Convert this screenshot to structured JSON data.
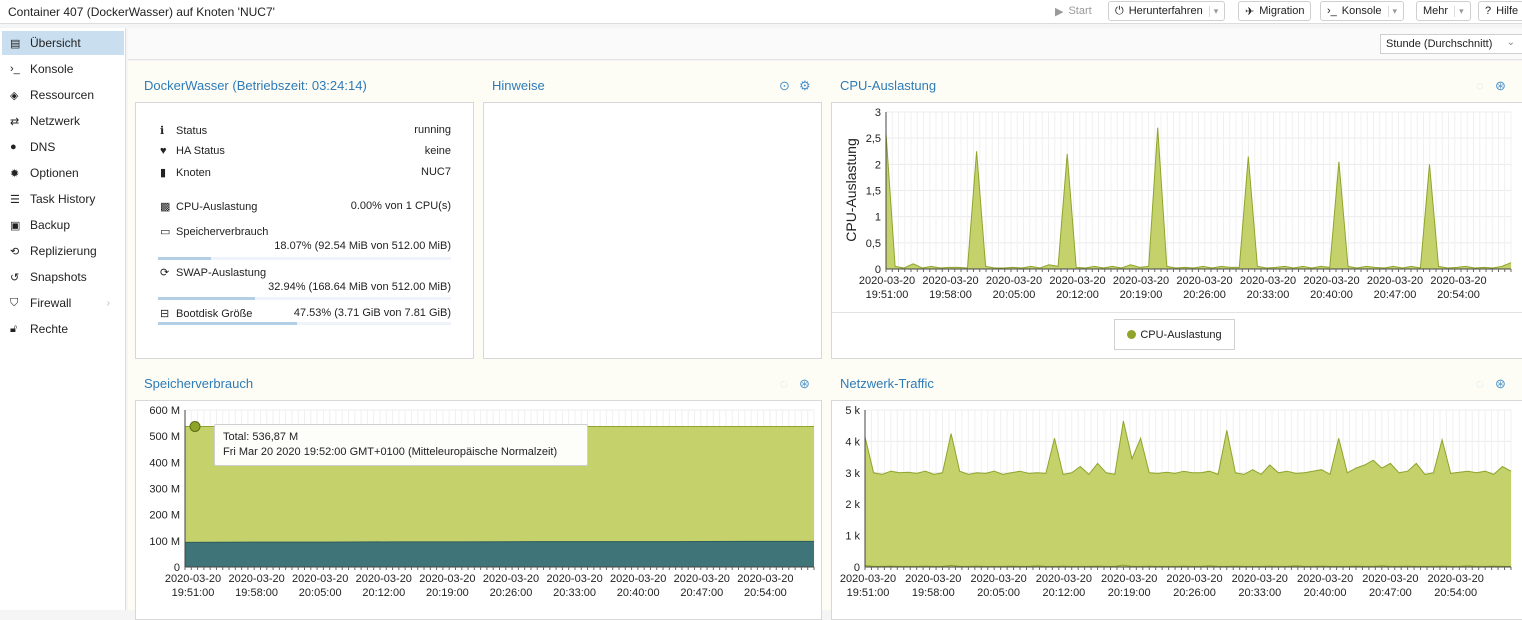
{
  "window": {
    "title": "Container 407 (DockerWasser) auf Knoten 'NUC7'"
  },
  "topbar": {
    "start_label": "Start",
    "shutdown_label": "Herunterfahren",
    "migration_label": "Migration",
    "console_label": "Konsole",
    "more_label": "Mehr",
    "help_label": "Hilfe"
  },
  "sidebar": {
    "items": [
      {
        "label": "Übersicht",
        "icon": "book-icon"
      },
      {
        "label": "Konsole",
        "icon": "terminal-icon"
      },
      {
        "label": "Ressourcen",
        "icon": "cube-icon"
      },
      {
        "label": "Netzwerk",
        "icon": "exchange-icon"
      },
      {
        "label": "DNS",
        "icon": "globe-icon"
      },
      {
        "label": "Optionen",
        "icon": "gear-icon"
      },
      {
        "label": "Task History",
        "icon": "list-icon"
      },
      {
        "label": "Backup",
        "icon": "floppy-icon"
      },
      {
        "label": "Replizierung",
        "icon": "retweet-icon"
      },
      {
        "label": "Snapshots",
        "icon": "history-icon"
      },
      {
        "label": "Firewall",
        "icon": "shield-icon"
      },
      {
        "label": "Rechte",
        "icon": "unlock-icon"
      }
    ]
  },
  "timeframe": {
    "selected": "Stunde (Durchschnitt)"
  },
  "status_panel": {
    "title": "DockerWasser (Betriebszeit: 03:24:14)",
    "rows": {
      "status": {
        "label": "Status",
        "value": "running"
      },
      "ha": {
        "label": "HA Status",
        "value": "keine"
      },
      "node": {
        "label": "Knoten",
        "value": "NUC7"
      },
      "cpu": {
        "label": "CPU-Auslastung",
        "value": "0.00% von 1 CPU(s)"
      },
      "mem": {
        "label": "Speicherverbrauch",
        "value": "18.07% (92.54 MiB von 512.00 MiB)",
        "fraction": 0.1807
      },
      "swap": {
        "label": "SWAP-Auslastung",
        "value": "32.94% (168.64 MiB von 512.00 MiB)",
        "fraction": 0.3294
      },
      "disk": {
        "label": "Bootdisk Größe",
        "value": "47.53% (3.71 GiB von 7.81 GiB)",
        "fraction": 0.4753
      }
    }
  },
  "notes_panel": {
    "title": "Hinweise"
  },
  "cpu_panel": {
    "title": "CPU-Auslastung",
    "legend": "CPU-Auslastung"
  },
  "mem_panel": {
    "title": "Speicherverbrauch",
    "tooltip_line1": "Total: 536,87 M",
    "tooltip_line2": "Fri Mar 20 2020 19:52:00 GMT+0100 (Mitteleuropäische Normalzeit)"
  },
  "net_panel": {
    "title": "Netzwerk-Traffic"
  },
  "colors": {
    "series_fill": "#c5d26c",
    "series_stroke": "#8ea52a",
    "used_fill": "#3f7478",
    "title_blue": "#2e7bb8"
  },
  "chart_data": [
    {
      "type": "area",
      "title": "CPU-Auslastung",
      "ylabel": "CPU-Auslastung",
      "ylim": [
        0,
        3
      ],
      "yticks": [
        "0",
        "0,5",
        "1",
        "1,5",
        "2",
        "2,5",
        "3"
      ],
      "xticks": [
        "2020-03-20 19:51:00",
        "2020-03-20 19:58:00",
        "2020-03-20 20:05:00",
        "2020-03-20 20:12:00",
        "2020-03-20 20:19:00",
        "2020-03-20 20:26:00",
        "2020-03-20 20:33:00",
        "2020-03-20 20:40:00",
        "2020-03-20 20:47:00",
        "2020-03-20 20:54:00"
      ],
      "grid": true,
      "legend_position": "bottom",
      "series": [
        {
          "name": "CPU-Auslastung",
          "values": [
            2.6,
            0.05,
            0.02,
            0.1,
            0.02,
            0.05,
            0.02,
            0.03,
            0.03,
            0.02,
            2.25,
            0.05,
            0.02,
            0.02,
            0.03,
            0.02,
            0.05,
            0.02,
            0.08,
            0.05,
            2.2,
            0.03,
            0.02,
            0.05,
            0.02,
            0.05,
            0.02,
            0.08,
            0.03,
            0.05,
            2.7,
            0.05,
            0.02,
            0.03,
            0.02,
            0.05,
            0.02,
            0.05,
            0.03,
            0.03,
            2.15,
            0.05,
            0.02,
            0.03,
            0.05,
            0.02,
            0.05,
            0.02,
            0.05,
            0.03,
            2.05,
            0.05,
            0.02,
            0.05,
            0.03,
            0.02,
            0.05,
            0.02,
            0.05,
            0.02,
            2.0,
            0.05,
            0.02,
            0.03,
            0.05,
            0.02,
            0.03,
            0.02,
            0.05,
            0.12
          ]
        }
      ]
    },
    {
      "type": "area",
      "title": "Speicherverbrauch",
      "ylim": [
        0,
        600
      ],
      "yticks": [
        "0",
        "100 M",
        "200 M",
        "300 M",
        "400 M",
        "500 M",
        "600 M"
      ],
      "xticks": [
        "2020-03-20 19:51:00",
        "2020-03-20 19:58:00",
        "2020-03-20 20:05:00",
        "2020-03-20 20:12:00",
        "2020-03-20 20:19:00",
        "2020-03-20 20:26:00",
        "2020-03-20 20:33:00",
        "2020-03-20 20:40:00",
        "2020-03-20 20:47:00",
        "2020-03-20 20:54:00"
      ],
      "grid": true,
      "series": [
        {
          "name": "Total",
          "values": [
            536.87,
            536.87,
            536.87,
            536.87,
            536.87,
            536.87,
            536.87,
            536.87,
            536.87,
            536.87
          ]
        },
        {
          "values": [
            94,
            95,
            95,
            96,
            96,
            97,
            97,
            97,
            98,
            98
          ]
        }
      ]
    },
    {
      "type": "area",
      "title": "Netzwerk-Traffic",
      "ylim": [
        0,
        5000
      ],
      "yticks": [
        "0",
        "1 k",
        "2 k",
        "3 k",
        "4 k",
        "5 k"
      ],
      "xticks": [
        "2020-03-20 19:51:00",
        "2020-03-20 19:58:00",
        "2020-03-20 20:05:00",
        "2020-03-20 20:12:00",
        "2020-03-20 20:19:00",
        "2020-03-20 20:26:00",
        "2020-03-20 20:33:00",
        "2020-03-20 20:40:00",
        "2020-03-20 20:47:00",
        "2020-03-20 20:54:00"
      ],
      "grid": true,
      "series": [
        {
          "values": [
            4150,
            3000,
            2950,
            3050,
            3000,
            3020,
            2980,
            3050,
            2950,
            3000,
            4250,
            3050,
            2950,
            3000,
            2980,
            3050,
            2950,
            3000,
            3050,
            2980,
            3000,
            2980,
            4100,
            2950,
            3000,
            3200,
            2950,
            3300,
            3000,
            2950,
            4650,
            3450,
            4100,
            3000,
            2980,
            3020,
            2980,
            3050,
            3000,
            3000,
            3050,
            2950,
            4350,
            3000,
            2950,
            3100,
            2950,
            3250,
            3000,
            3050,
            2980,
            3000,
            3050,
            3100,
            2950,
            4100,
            3000,
            3150,
            3250,
            3400,
            3150,
            3300,
            3000,
            3050,
            3300,
            2950,
            3000,
            4050,
            2980,
            3020,
            3050,
            3000,
            3050,
            2950,
            3200,
            3050
          ]
        },
        {
          "values": [
            50,
            20,
            20,
            30,
            20,
            20,
            20,
            30,
            20,
            20,
            50,
            20,
            20,
            30,
            20,
            20,
            20,
            30,
            20,
            20,
            40,
            20,
            20,
            30,
            20,
            20,
            20,
            30,
            20,
            20,
            60,
            20,
            20,
            30,
            20,
            20,
            20,
            30,
            20,
            20,
            40,
            20,
            20,
            30,
            20,
            20,
            20,
            30,
            20,
            20,
            40,
            20,
            20,
            30,
            20,
            20,
            20,
            30,
            20,
            20,
            40,
            20,
            20,
            30,
            20,
            20,
            20,
            30,
            20,
            20,
            40,
            20,
            20,
            30,
            20,
            20
          ]
        }
      ]
    }
  ]
}
